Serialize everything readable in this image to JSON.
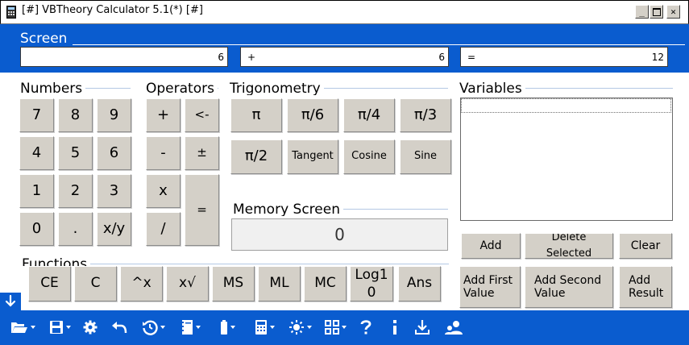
{
  "window": {
    "title": "[#] VBTheory Calculator 5.1(*) [#]"
  },
  "screen": {
    "label": "Screen",
    "display1": {
      "value": "6"
    },
    "display2": {
      "op": "+",
      "value": "6"
    },
    "display3": {
      "op": "=",
      "value": "12"
    }
  },
  "groups": {
    "numbers": "Numbers",
    "operators": "Operators",
    "trigonometry": "Trigonometry",
    "variables": "Variables",
    "memory_screen": "Memory Screen",
    "functions": "Functions"
  },
  "numbers": [
    "7",
    "8",
    "9",
    "4",
    "5",
    "6",
    "1",
    "2",
    "3",
    "0",
    ".",
    "x/y"
  ],
  "operators": {
    "plus": "+",
    "backspace": "<-",
    "minus": "-",
    "plusminus": "±",
    "multiply": "x",
    "divide": "/",
    "equals": "="
  },
  "trig": [
    "π",
    "π/6",
    "π/4",
    "π/3",
    "π/2",
    "Tangent",
    "Cosine",
    "Sine"
  ],
  "memory": {
    "value": "0"
  },
  "functions": [
    "CE",
    "C",
    "^x",
    "x√",
    "MS",
    "ML",
    "MC",
    "Log10",
    "Ans"
  ],
  "variables": {
    "buttons": {
      "add": "Add",
      "delete": "Delete Selected",
      "clear": "Clear",
      "add_first": "Add First Value",
      "add_second": "Add Second Value",
      "add_result": "Add Result"
    }
  },
  "toolbar": {
    "icons": [
      "folder-open-icon",
      "save-icon",
      "gear-icon",
      "undo-icon",
      "history-icon",
      "notebook-icon",
      "battery-icon",
      "calculator-icon",
      "theme-icon",
      "grid-icon",
      "help-icon",
      "info-icon",
      "download-icon",
      "users-icon"
    ],
    "accent": "#0a5ccf"
  }
}
